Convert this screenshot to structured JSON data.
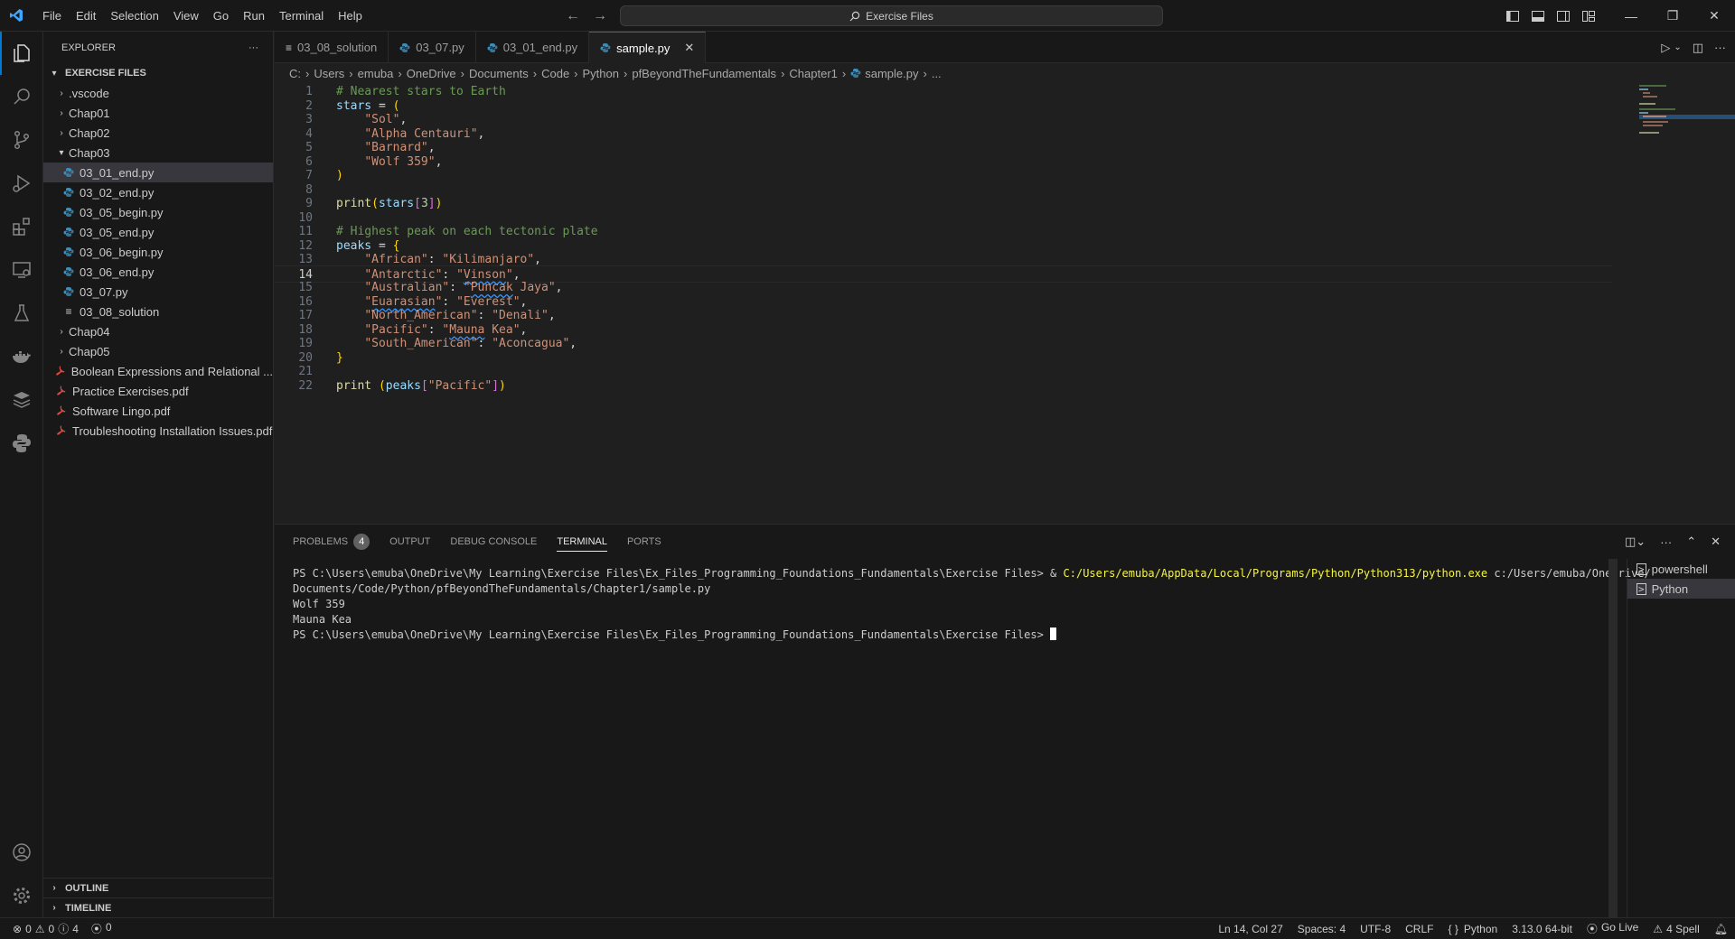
{
  "titlebar": {
    "menu": [
      "File",
      "Edit",
      "Selection",
      "View",
      "Go",
      "Run",
      "Terminal",
      "Help"
    ],
    "search": "Exercise Files"
  },
  "sidebar": {
    "title": "EXPLORER",
    "root": "EXERCISE FILES",
    "tree": [
      {
        "label": ".vscode",
        "type": "folder",
        "depth": 1
      },
      {
        "label": "Chap01",
        "type": "folder",
        "depth": 1
      },
      {
        "label": "Chap02",
        "type": "folder",
        "depth": 1
      },
      {
        "label": "Chap03",
        "type": "folder-open",
        "depth": 1
      },
      {
        "label": "03_01_end.py",
        "type": "py",
        "depth": 2,
        "selected": true
      },
      {
        "label": "03_02_end.py",
        "type": "py",
        "depth": 2
      },
      {
        "label": "03_05_begin.py",
        "type": "py",
        "depth": 2
      },
      {
        "label": "03_05_end.py",
        "type": "py",
        "depth": 2
      },
      {
        "label": "03_06_begin.py",
        "type": "py",
        "depth": 2
      },
      {
        "label": "03_06_end.py",
        "type": "py",
        "depth": 2
      },
      {
        "label": "03_07.py",
        "type": "py",
        "depth": 2
      },
      {
        "label": "03_08_solution",
        "type": "txt",
        "depth": 2
      },
      {
        "label": "Chap04",
        "type": "folder",
        "depth": 1
      },
      {
        "label": "Chap05",
        "type": "folder",
        "depth": 1
      },
      {
        "label": "Boolean Expressions and Relational ...",
        "type": "pdf",
        "depth": 1
      },
      {
        "label": "Practice Exercises.pdf",
        "type": "pdf",
        "depth": 1
      },
      {
        "label": "Software Lingo.pdf",
        "type": "pdf",
        "depth": 1
      },
      {
        "label": "Troubleshooting Installation Issues.pdf",
        "type": "pdf",
        "depth": 1
      }
    ],
    "outline": "OUTLINE",
    "timeline": "TIMELINE"
  },
  "tabs": [
    {
      "label": "03_08_solution",
      "icon": "txt"
    },
    {
      "label": "03_07.py",
      "icon": "py"
    },
    {
      "label": "03_01_end.py",
      "icon": "py"
    },
    {
      "label": "sample.py",
      "icon": "py",
      "active": true
    }
  ],
  "breadcrumb": [
    "C:",
    "Users",
    "emuba",
    "OneDrive",
    "Documents",
    "Code",
    "Python",
    "pfBeyondTheFundamentals",
    "Chapter1",
    "sample.py",
    "..."
  ],
  "editor": {
    "current_line": 14,
    "lines": [
      {
        "n": "1",
        "html": "<span class='tok-comment'># Nearest stars to Earth</span>"
      },
      {
        "n": "2",
        "html": "<span class='tok-var'>stars</span><span class='tok-op'> = </span><span class='tok-paren'>(</span>"
      },
      {
        "n": "3",
        "html": "    <span class='tok-str'>\"Sol\"</span><span class='tok-op'>,</span>"
      },
      {
        "n": "4",
        "html": "    <span class='tok-str'>\"Alpha Centauri\"</span><span class='tok-op'>,</span>"
      },
      {
        "n": "5",
        "html": "    <span class='tok-str'>\"Barnard\"</span><span class='tok-op'>,</span>"
      },
      {
        "n": "6",
        "html": "    <span class='tok-str'>\"Wolf 359\"</span><span class='tok-op'>,</span>"
      },
      {
        "n": "7",
        "html": "<span class='tok-paren'>)</span>"
      },
      {
        "n": "8",
        "html": ""
      },
      {
        "n": "9",
        "html": "<span class='tok-fn'>print</span><span class='tok-paren'>(</span><span class='tok-var'>stars</span><span class='tok-paren2'>[</span><span class='tok-num'>3</span><span class='tok-paren2'>]</span><span class='tok-paren'>)</span>"
      },
      {
        "n": "10",
        "html": ""
      },
      {
        "n": "11",
        "html": "<span class='tok-comment'># Highest peak on each tectonic plate</span>"
      },
      {
        "n": "12",
        "html": "<span class='tok-var'>peaks</span><span class='tok-op'> = </span><span class='tok-paren'>{</span>"
      },
      {
        "n": "13",
        "html": "    <span class='tok-str'>\"African\"</span><span class='tok-op'>: </span><span class='tok-str'>\"Kilimanjaro\"</span><span class='tok-op'>,</span>"
      },
      {
        "n": "14",
        "html": "    <span class='tok-str'>\"Antarctic\"</span><span class='tok-op'>: </span><span class='tok-str'>\"<span class='squiggle'>Vinson</span>\"</span><span class='tok-op'>,</span>"
      },
      {
        "n": "15",
        "html": "    <span class='tok-str'>\"Australian\"</span><span class='tok-op'>: </span><span class='tok-str'>\"<span class='squiggle'>Puncak</span> Jaya\"</span><span class='tok-op'>,</span>"
      },
      {
        "n": "16",
        "html": "    <span class='tok-str'>\"<span class='squiggle'>Euarasian</span>\"</span><span class='tok-op'>: </span><span class='tok-str'>\"Everest\"</span><span class='tok-op'>,</span>"
      },
      {
        "n": "17",
        "html": "    <span class='tok-str'>\"North_American\"</span><span class='tok-op'>: </span><span class='tok-str'>\"Denali\"</span><span class='tok-op'>,</span>"
      },
      {
        "n": "18",
        "html": "    <span class='tok-str'>\"Pacific\"</span><span class='tok-op'>: </span><span class='tok-str'>\"<span class='squiggle'>Mauna</span> Kea\"</span><span class='tok-op'>,</span>"
      },
      {
        "n": "19",
        "html": "    <span class='tok-str'>\"South_American\"</span><span class='tok-op'>: </span><span class='tok-str'>\"Aconcagua\"</span><span class='tok-op'>,</span>"
      },
      {
        "n": "20",
        "html": "<span class='tok-paren'>}</span>"
      },
      {
        "n": "21",
        "html": ""
      },
      {
        "n": "22",
        "html": "<span class='tok-fn'>print</span><span class='tok-op'> </span><span class='tok-paren'>(</span><span class='tok-var'>peaks</span><span class='tok-paren2'>[</span><span class='tok-str'>\"Pacific\"</span><span class='tok-paren2'>]</span><span class='tok-paren'>)</span>"
      }
    ]
  },
  "panel": {
    "tabs": [
      "PROBLEMS",
      "OUTPUT",
      "DEBUG CONSOLE",
      "TERMINAL",
      "PORTS"
    ],
    "problems_count": "4",
    "terminal_lines": [
      {
        "prompt": "PS C:\\Users\\emuba\\OneDrive\\My Learning\\Exercise Files\\Ex_Files_Programming_Foundations_Fundamentals\\Exercise Files> & ",
        "cmd": "C:/Users/emuba/AppData/Local/Programs/Python/Python313/python.exe",
        "rest": " c:/Users/emuba/OneDrive/"
      },
      {
        "prompt": "Documents/Code/Python/pfBeyondTheFundamentals/Chapter1/sample.py",
        "cmd": "",
        "rest": ""
      },
      {
        "prompt": "Wolf 359",
        "cmd": "",
        "rest": ""
      },
      {
        "prompt": "Mauna Kea",
        "cmd": "",
        "rest": ""
      },
      {
        "prompt": "PS C:\\Users\\emuba\\OneDrive\\My Learning\\Exercise Files\\Ex_Files_Programming_Foundations_Fundamentals\\Exercise Files> ",
        "cmd": "",
        "rest": "",
        "cursor": true
      }
    ],
    "terminals": [
      "powershell",
      "Python"
    ]
  },
  "statusbar": {
    "errors": "0",
    "warnings": "0",
    "infos": "4",
    "ports": "0",
    "position": "Ln 14, Col 27",
    "spaces": "Spaces: 4",
    "encoding": "UTF-8",
    "eol": "CRLF",
    "language": "Python",
    "interpreter": "3.13.0 64-bit",
    "golive": "Go Live",
    "spell": "4 Spell"
  },
  "colors": {
    "accent": "#0078d4",
    "python_icon": "#3c8dbc",
    "pdf_icon": "#e04b3f"
  }
}
